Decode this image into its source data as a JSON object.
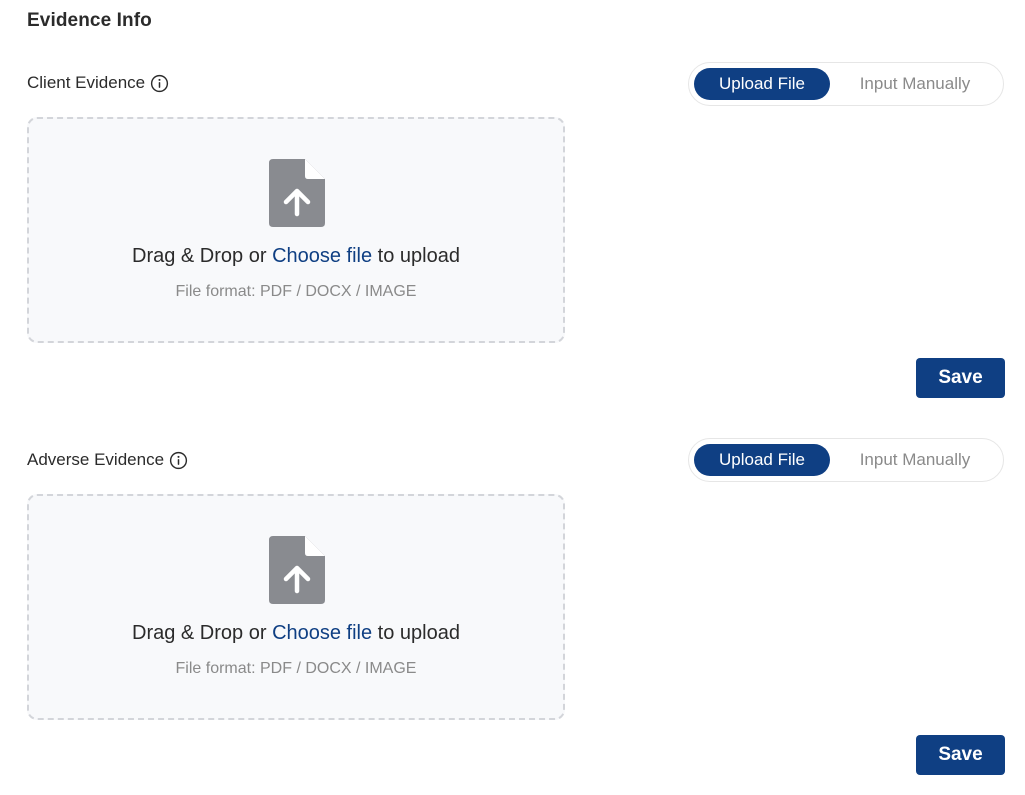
{
  "page": {
    "title": "Evidence Info"
  },
  "sections": [
    {
      "label": "Client Evidence",
      "toggle": {
        "active": "Upload File",
        "inactive": "Input Manually"
      },
      "dropzone": {
        "text_before": "Drag & Drop or ",
        "link": "Choose file",
        "text_after": " to upload",
        "format": "File format: PDF / DOCX / IMAGE"
      },
      "save_label": "Save"
    },
    {
      "label": "Adverse Evidence",
      "toggle": {
        "active": "Upload File",
        "inactive": "Input Manually"
      },
      "dropzone": {
        "text_before": "Drag & Drop or ",
        "link": "Choose file",
        "text_after": " to upload",
        "format": "File format: PDF / DOCX / IMAGE"
      },
      "save_label": "Save"
    }
  ],
  "icons": {
    "info": "info-circle-icon",
    "file_upload": "file-upload-icon"
  },
  "colors": {
    "primary": "#0f3f83",
    "muted": "#8a8a8a",
    "dropzone_bg": "#f8f9fb",
    "dropzone_border": "#d3d5da"
  }
}
